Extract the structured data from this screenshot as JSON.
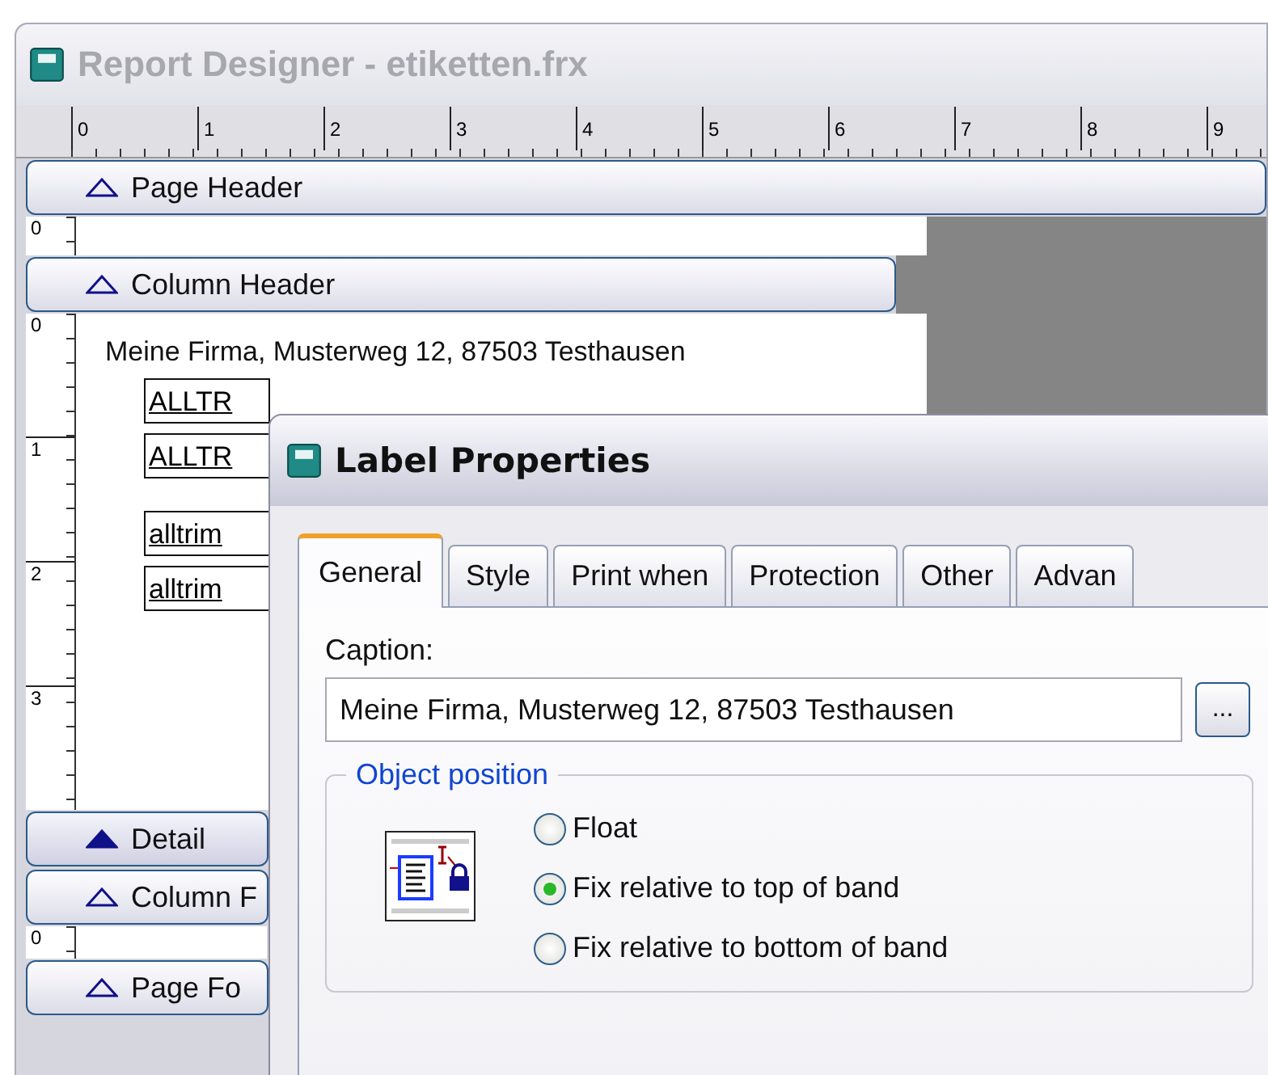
{
  "designer": {
    "title": "Report Designer - etiketten.frx",
    "ruler": [
      "0",
      "1",
      "2",
      "3",
      "4",
      "5",
      "6",
      "7",
      "8",
      "9"
    ],
    "sections": [
      {
        "kind": "band",
        "label": "Page Header",
        "selected": false
      },
      {
        "kind": "area",
        "marks": [
          "0"
        ]
      },
      {
        "kind": "band",
        "label": "Column Header",
        "selected": false
      },
      {
        "kind": "area",
        "marks": [
          "0",
          "1",
          "2",
          "3"
        ],
        "text": "Meine Firma, Musterweg 12, 87503 Testhausen",
        "fields": [
          "ALLTR",
          "ALLTR",
          "alltrim",
          "alltrim"
        ]
      },
      {
        "kind": "band",
        "label": "Detail",
        "selected": true
      },
      {
        "kind": "band",
        "label": "Column F",
        "selected": false
      },
      {
        "kind": "area",
        "marks": [
          "0"
        ]
      },
      {
        "kind": "band",
        "label": "Page Fo",
        "selected": false
      }
    ]
  },
  "dialog": {
    "title": "Label Properties",
    "tabs": [
      {
        "label": "General",
        "selected": true
      },
      {
        "label": "Style",
        "selected": false
      },
      {
        "label": "Print when",
        "selected": false
      },
      {
        "label": "Protection",
        "selected": false
      },
      {
        "label": "Other",
        "selected": false
      },
      {
        "label": "Advan",
        "selected": false
      }
    ],
    "caption": {
      "label": "Caption:",
      "value": "Meine Firma, Musterweg 12, 87503 Testhausen",
      "button": "..."
    },
    "object_position": {
      "title": "Object position",
      "options": [
        {
          "label": "Float",
          "selected": false
        },
        {
          "label": "Fix relative to top of band",
          "selected": true
        },
        {
          "label": "Fix relative to bottom of band",
          "selected": false
        }
      ]
    }
  }
}
